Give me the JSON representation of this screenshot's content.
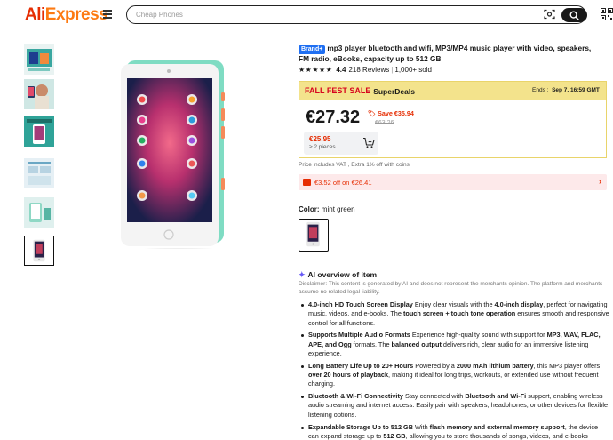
{
  "header": {
    "logo_part1": "Ali",
    "logo_part2": "Express",
    "search_placeholder": "Cheap Phones"
  },
  "product": {
    "brand_badge": "Brand+",
    "title": "mp3 player bluetooth and wifi, MP3/MP4 music player with video, speakers, FM radio, eBooks, capacity up to 512 GB",
    "stars": "★★★★★",
    "rating": "4.4",
    "reviews": "218 Reviews",
    "sold": "1,000+ sold"
  },
  "sale": {
    "label": "FALL FEST SALE",
    "deal": "· SuperDeals",
    "ends_label": "Ends :",
    "ends_date": "Sep 7, 16:59 GMT",
    "price": "€27.32",
    "save": "Save €35.94",
    "old_price": "€63.26",
    "bulk_price": "€25.95",
    "bulk_qty": "≥ 2 pieces",
    "vat_note": "Price includes VAT , Extra 1% off with coins",
    "coupon": "€3.52 off on €26.41"
  },
  "variant": {
    "label": "Color:",
    "value": "mint green"
  },
  "ai": {
    "heading": "AI overview of item",
    "disclaimer": "Disclaimer: This content is generated by AI and does not represent the merchants opinion. The platform and merchants assume no related legal liability.",
    "bullets": [
      {
        "title": "4.0-inch HD Touch Screen Display",
        "parts": [
          " Enjoy clear visuals with the ",
          "4.0-inch display",
          ", perfect for navigating music, videos, and e-books. The ",
          "touch screen + touch tone operation",
          " ensures smooth and responsive control for all functions."
        ]
      },
      {
        "title": "Supports Multiple Audio Formats",
        "parts": [
          " Experience high-quality sound with support for ",
          "MP3, WAV, FLAC, APE, and Ogg",
          " formats. The ",
          "balanced output",
          " delivers rich, clear audio for an immersive listening experience."
        ]
      },
      {
        "title": "Long Battery Life Up to 20+ Hours",
        "parts": [
          " Powered by a ",
          "2000 mAh lithium battery",
          ", this MP3 player offers ",
          "over 20 hours of playback",
          ", making it ideal for long trips, workouts, or extended use without frequent charging."
        ]
      },
      {
        "title": "Bluetooth & Wi-Fi Connectivity",
        "parts": [
          " Stay connected with ",
          "Bluetooth and Wi-Fi",
          " support, enabling wireless audio streaming and internet access. Easily pair with speakers, headphones, or other devices for flexible listening options.",
          "",
          ""
        ]
      },
      {
        "title": "Expandable Storage Up to 512 GB",
        "parts": [
          " With ",
          "flash memory and external memory support",
          ", the device can expand storage up to ",
          "512 GB",
          ", allowing you to store thousands of songs, videos, and e-books"
        ]
      }
    ]
  },
  "colors": {
    "brand_red": "#e62e04",
    "brand_orange": "#fd7a12",
    "fest_yellow": "#f3e38c",
    "badge_blue": "#1f6ff2",
    "ai_purple": "#6a5cf6"
  }
}
